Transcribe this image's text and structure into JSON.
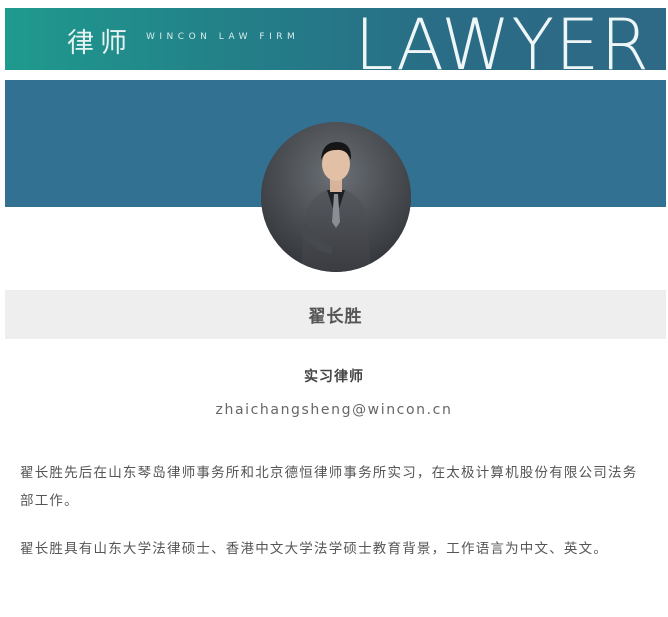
{
  "banner": {
    "cn_title": "律师",
    "en_subtitle": "WINCON LAW FIRM",
    "big_word": "LAWYER",
    "colors": {
      "start": "#1f9a8e",
      "end": "#2e6a86"
    }
  },
  "hero": {
    "color": "#327192"
  },
  "profile": {
    "name": "翟长胜",
    "role": "实习律师",
    "email": "zhaichangsheng@wincon.cn",
    "photo": "portrait-photo"
  },
  "bio": {
    "paragraphs": [
      "翟长胜先后在山东琴岛律师事务所和北京德恒律师事务所实习，在太极计算机股份有限公司法务部工作。",
      "翟长胜具有山东大学法律硕士、香港中文大学法学硕士教育背景，工作语言为中文、英文。"
    ]
  }
}
